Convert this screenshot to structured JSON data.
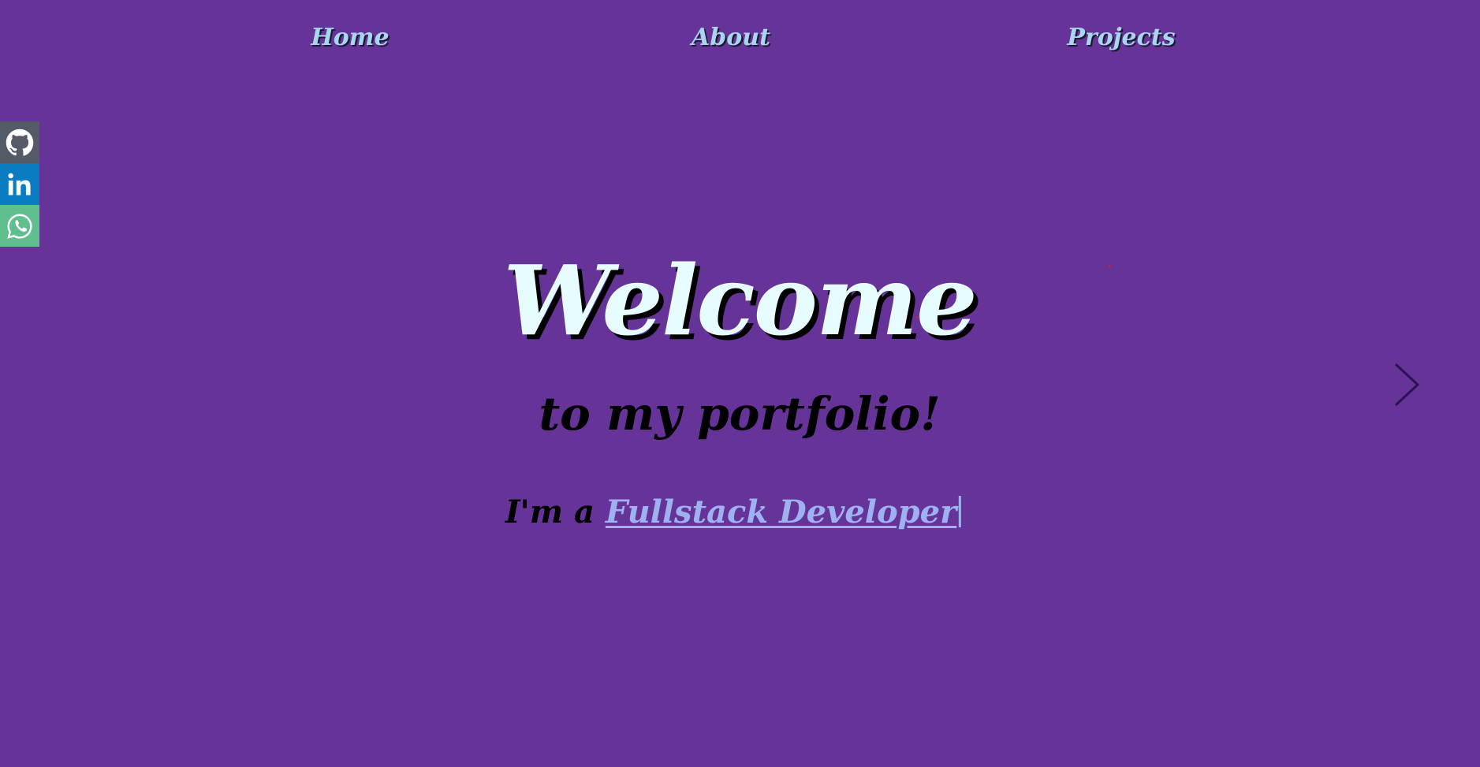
{
  "nav": {
    "home_label": "Home",
    "about_label": "About",
    "projects_label": "Projects"
  },
  "social": {
    "items": [
      {
        "name": "github",
        "icon": "github-icon",
        "color": "#555b66"
      },
      {
        "name": "linkedin",
        "icon": "linkedin-icon",
        "color": "#0a7cc2"
      },
      {
        "name": "whatsapp",
        "icon": "whatsapp-icon",
        "color": "#5fbf8f"
      }
    ]
  },
  "hero": {
    "title": "Welcome",
    "subtitle": "to my portfolio!",
    "role_prefix": "I'm a ",
    "role_text": "Fullstack Developer"
  },
  "carousel": {
    "next_icon": "chevron-right-icon"
  },
  "colors": {
    "background": "#663399",
    "nav_link": "#a9d4f2",
    "title_fill": "#e6fcff",
    "role_highlight": "#9fb2f0"
  }
}
